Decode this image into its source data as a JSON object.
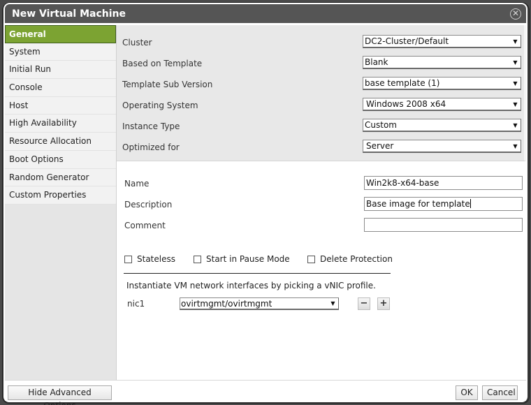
{
  "dialog": {
    "title": "New Virtual Machine",
    "close_icon": "close-circle-icon"
  },
  "sidebar": {
    "items": [
      {
        "label": "General",
        "active": true
      },
      {
        "label": "System",
        "active": false
      },
      {
        "label": "Initial Run",
        "active": false
      },
      {
        "label": "Console",
        "active": false
      },
      {
        "label": "Host",
        "active": false
      },
      {
        "label": "High Availability",
        "active": false
      },
      {
        "label": "Resource Allocation",
        "active": false
      },
      {
        "label": "Boot Options",
        "active": false
      },
      {
        "label": "Random Generator",
        "active": false
      },
      {
        "label": "Custom Properties",
        "active": false
      }
    ]
  },
  "general": {
    "selects": [
      {
        "label": "Cluster",
        "value": "DC2-Cluster/Default"
      },
      {
        "label": "Based on Template",
        "value": "Blank"
      },
      {
        "label": "Template Sub Version",
        "value": "base template (1)"
      },
      {
        "label": "Operating System",
        "value": "Windows 2008 x64"
      },
      {
        "label": "Instance Type",
        "value": "Custom"
      },
      {
        "label": "Optimized for",
        "value": "Server"
      }
    ],
    "fields": {
      "name": {
        "label": "Name",
        "value": "Win2k8-x64-base"
      },
      "description": {
        "label": "Description",
        "value": "Base image for template"
      },
      "comment": {
        "label": "Comment",
        "value": ""
      }
    },
    "checkboxes": [
      {
        "label": "Stateless",
        "checked": false
      },
      {
        "label": "Start in Pause Mode",
        "checked": false
      },
      {
        "label": "Delete Protection",
        "checked": false
      }
    ],
    "vnic": {
      "instruction": "Instantiate VM network interfaces by picking a vNIC profile.",
      "nic_label": "nic1",
      "profile": "ovirtmgmt/ovirtmgmt",
      "remove_label": "−",
      "add_label": "+"
    }
  },
  "footer": {
    "hide_advanced": "Hide Advanced Options",
    "ok": "OK",
    "cancel": "Cancel"
  },
  "colors": {
    "active_tab": "#7ca332",
    "titlebar": "#555555",
    "panel_bg": "#e8e8e8"
  },
  "icons": {
    "dropdown_arrow": "▼",
    "close": "✕"
  }
}
